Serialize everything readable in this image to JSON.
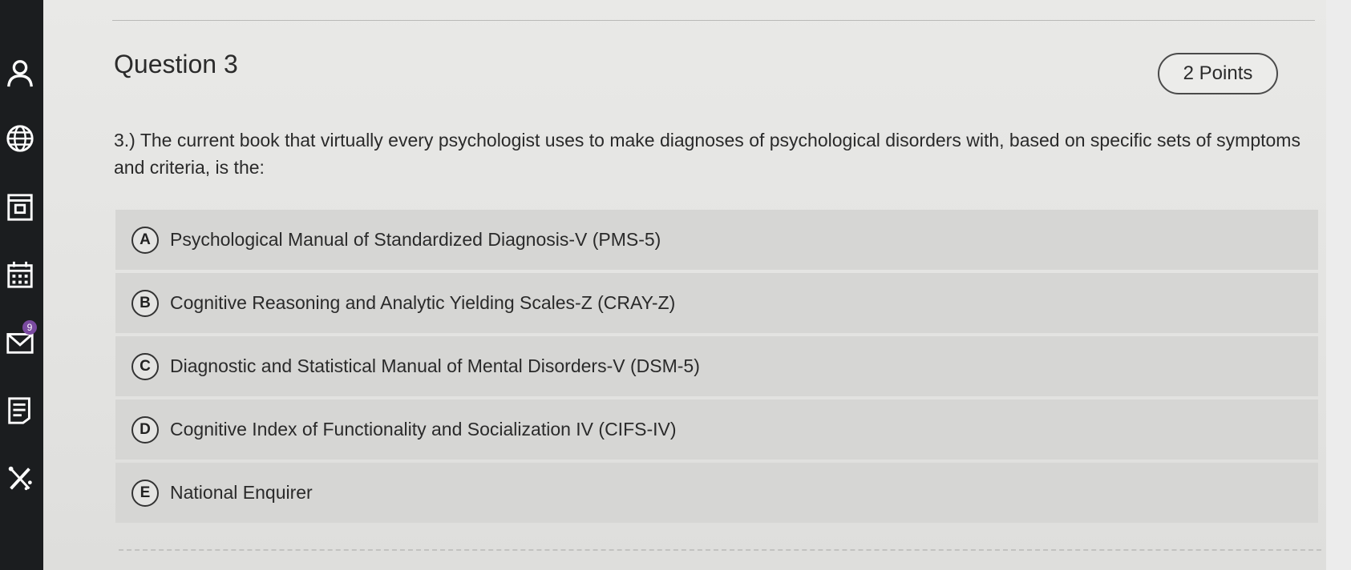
{
  "nav": {
    "items": [
      {
        "icon": "profile-icon"
      },
      {
        "icon": "globe-icon"
      },
      {
        "icon": "courses-icon"
      },
      {
        "icon": "calendar-icon"
      },
      {
        "icon": "messages-icon",
        "badge": "9"
      },
      {
        "icon": "grades-icon"
      },
      {
        "icon": "tools-icon"
      }
    ]
  },
  "question": {
    "title": "Question 3",
    "points": "2 Points",
    "text": "3.) The current book that virtually every psychologist uses to make diagnoses of psychological disorders with, based on specific sets of symptoms and criteria, is the:",
    "options": [
      {
        "letter": "A",
        "text": "Psychological Manual of Standardized Diagnosis-V (PMS-5)"
      },
      {
        "letter": "B",
        "text": "Cognitive Reasoning and Analytic Yielding Scales-Z (CRAY-Z)"
      },
      {
        "letter": "C",
        "text": "Diagnostic and Statistical Manual of Mental Disorders-V (DSM-5)"
      },
      {
        "letter": "D",
        "text": "Cognitive Index of Functionality and Socialization IV (CIFS-IV)"
      },
      {
        "letter": "E",
        "text": "National Enquirer"
      }
    ]
  },
  "colors": {
    "rail": "#1b1d1f",
    "badge": "#7a4aa0",
    "option_bg": "#d6d6d4"
  }
}
